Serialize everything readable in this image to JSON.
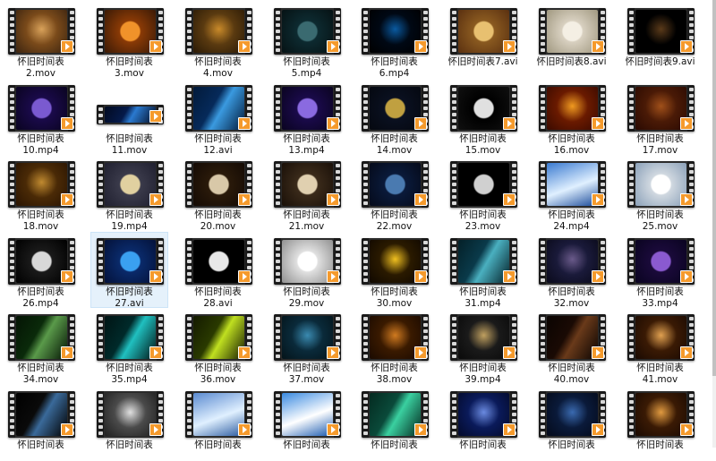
{
  "window": {
    "view": "large-icons"
  },
  "files": [
    {
      "line1": "怀旧时间表",
      "line2": "2.mov",
      "colors": [
        "#7a4a1a",
        "#d9a25a",
        "#3b2410"
      ],
      "icon": "gear-icon"
    },
    {
      "line1": "怀旧时间表",
      "line2": "3.mov",
      "colors": [
        "#8a3a06",
        "#f0922a",
        "#3a1a06"
      ],
      "icon": "clock-icon"
    },
    {
      "line1": "怀旧时间表",
      "line2": "4.mov",
      "colors": [
        "#5a3a10",
        "#c98a2a",
        "#2a1a06"
      ],
      "icon": "gear-icon"
    },
    {
      "line1": "怀旧时间表",
      "line2": "5.mp4",
      "colors": [
        "#0d2a30",
        "#3a6a70",
        "#061214"
      ],
      "icon": "clock-icon"
    },
    {
      "line1": "怀旧时间表",
      "line2": "6.mp4",
      "colors": [
        "#000814",
        "#0a5aa0",
        "#000000"
      ],
      "icon": "pendulum-icon"
    },
    {
      "line1": "怀旧时间表7.avi",
      "line2": "",
      "colors": [
        "#8a5a20",
        "#e8c070",
        "#5a3010"
      ],
      "icon": "clock-icon"
    },
    {
      "line1": "怀旧时间表8.avi",
      "line2": "",
      "colors": [
        "#d8d0c0",
        "#f4efe4",
        "#a09880"
      ],
      "icon": "clock-icon"
    },
    {
      "line1": "怀旧时间表9.avi",
      "line2": "",
      "colors": [
        "#000000",
        "#5a3a1a",
        "#000000"
      ],
      "icon": "lantern-icon"
    },
    {
      "line1": "怀旧时间表",
      "line2": "10.mp4",
      "colors": [
        "#1a0a4a",
        "#7a5ad0",
        "#0a0420"
      ],
      "icon": "clock-icon"
    },
    {
      "line1": "怀旧时间表",
      "line2": "11.mov",
      "colors": [
        "#051a4a",
        "#2a7ad0",
        "#020a20"
      ],
      "icon": "light-icon",
      "short": true
    },
    {
      "line1": "怀旧时间表",
      "line2": "12.avi",
      "colors": [
        "#062a5a",
        "#3a9ae0",
        "#021a3a"
      ],
      "icon": "light-icon"
    },
    {
      "line1": "怀旧时间表",
      "line2": "13.mp4",
      "colors": [
        "#1a0a4a",
        "#8a6ae0",
        "#0a0420"
      ],
      "icon": "clock-icon"
    },
    {
      "line1": "怀旧时间表",
      "line2": "14.mov",
      "colors": [
        "#0a1020",
        "#c0a040",
        "#050810"
      ],
      "icon": "clock-icon"
    },
    {
      "line1": "怀旧时间表",
      "line2": "15.mov",
      "colors": [
        "#000000",
        "#e0e0e0",
        "#101010"
      ],
      "icon": "clock-icon"
    },
    {
      "line1": "怀旧时间表",
      "line2": "16.mov",
      "colors": [
        "#6a1a00",
        "#f09a20",
        "#3a0a00"
      ],
      "icon": "gear-icon"
    },
    {
      "line1": "怀旧时间表",
      "line2": "17.mov",
      "colors": [
        "#4a1a06",
        "#a0501a",
        "#2a0a02"
      ],
      "icon": "gear-icon"
    },
    {
      "line1": "怀旧时间表",
      "line2": "18.mov",
      "colors": [
        "#4a2a06",
        "#c08a30",
        "#2a1402"
      ],
      "icon": "gear-icon"
    },
    {
      "line1": "怀旧时间表",
      "line2": "19.mp4",
      "colors": [
        "#3a3a4a",
        "#e0d0a0",
        "#202030"
      ],
      "icon": "clock-icon"
    },
    {
      "line1": "怀旧时间表",
      "line2": "20.mov",
      "colors": [
        "#2a1a0a",
        "#d8c8a8",
        "#140a04"
      ],
      "icon": "clock-icon"
    },
    {
      "line1": "怀旧时间表",
      "line2": "21.mov",
      "colors": [
        "#3a2a1a",
        "#e0d0b0",
        "#1a1008"
      ],
      "icon": "clock-icon"
    },
    {
      "line1": "怀旧时间表",
      "line2": "22.mov",
      "colors": [
        "#0a1a3a",
        "#4a7ab0",
        "#050a1a"
      ],
      "icon": "clock-icon"
    },
    {
      "line1": "怀旧时间表",
      "line2": "23.mov",
      "colors": [
        "#000000",
        "#d0d0d0",
        "#000000"
      ],
      "icon": "clock-icon"
    },
    {
      "line1": "怀旧时间表",
      "line2": "24.mp4",
      "colors": [
        "#3a7ad0",
        "#e0f0ff",
        "#1a4a9a"
      ],
      "icon": "sky-icon"
    },
    {
      "line1": "怀旧时间表",
      "line2": "25.mov",
      "colors": [
        "#d0d8e0",
        "#ffffff",
        "#8aa0b8"
      ],
      "icon": "clock-icon"
    },
    {
      "line1": "怀旧时间表",
      "line2": "26.mp4",
      "colors": [
        "#1a1a1a",
        "#d8d8d8",
        "#000000"
      ],
      "icon": "clock-icon"
    },
    {
      "line1": "怀旧时间表",
      "line2": "27.avi",
      "colors": [
        "#0a2a6a",
        "#3aa0f0",
        "#04123a"
      ],
      "icon": "clock-icon",
      "selected": true
    },
    {
      "line1": "怀旧时间表",
      "line2": "28.avi",
      "colors": [
        "#000000",
        "#e8e8e8",
        "#000000"
      ],
      "icon": "clock-icon"
    },
    {
      "line1": "怀旧时间表",
      "line2": "29.mov",
      "colors": [
        "#e0e0e0",
        "#ffffff",
        "#909090"
      ],
      "icon": "clock-icon"
    },
    {
      "line1": "怀旧时间表",
      "line2": "30.mov",
      "colors": [
        "#2a1a00",
        "#f0c020",
        "#100800"
      ],
      "icon": "sparkle-icon"
    },
    {
      "line1": "怀旧时间表",
      "line2": "31.mp4",
      "colors": [
        "#0a3a4a",
        "#4ab0c0",
        "#042028"
      ],
      "icon": "light-icon"
    },
    {
      "line1": "怀旧时间表",
      "line2": "32.mov",
      "colors": [
        "#1a1a3a",
        "#6a5a8a",
        "#0a0a1a"
      ],
      "icon": "city-icon"
    },
    {
      "line1": "怀旧时间表",
      "line2": "33.mp4",
      "colors": [
        "#1a0a3a",
        "#8a5ad0",
        "#0a0420"
      ],
      "icon": "clock-icon"
    },
    {
      "line1": "怀旧时间表",
      "line2": "34.mov",
      "colors": [
        "#0a2a0a",
        "#5a9a4a",
        "#041404"
      ],
      "icon": "light-icon"
    },
    {
      "line1": "怀旧时间表",
      "line2": "35.mp4",
      "colors": [
        "#002a2a",
        "#20c0c0",
        "#001414"
      ],
      "icon": "light-icon"
    },
    {
      "line1": "怀旧时间表",
      "line2": "36.mov",
      "colors": [
        "#2a3a00",
        "#c0e020",
        "#141a00"
      ],
      "icon": "light-icon"
    },
    {
      "line1": "怀旧时间表",
      "line2": "37.mov",
      "colors": [
        "#0a2a3a",
        "#3a8ab0",
        "#04141a"
      ],
      "icon": "gear-icon"
    },
    {
      "line1": "怀旧时间表",
      "line2": "38.mov",
      "colors": [
        "#3a1a00",
        "#d07a20",
        "#1a0a00"
      ],
      "icon": "city-icon"
    },
    {
      "line1": "怀旧时间表",
      "line2": "39.mp4",
      "colors": [
        "#1a1a1a",
        "#c0a060",
        "#0a0a0a"
      ],
      "icon": "coin-icon"
    },
    {
      "line1": "怀旧时间表",
      "line2": "40.mov",
      "colors": [
        "#1a0a04",
        "#6a3a1a",
        "#0a0402"
      ],
      "icon": "light-icon"
    },
    {
      "line1": "怀旧时间表",
      "line2": "41.mov",
      "colors": [
        "#3a1a04",
        "#e0a050",
        "#1a0a02"
      ],
      "icon": "city-icon"
    },
    {
      "line1": "怀旧时间表",
      "line2": "",
      "colors": [
        "#0a0a0a",
        "#3a6a9a",
        "#000000"
      ],
      "icon": "light-icon"
    },
    {
      "line1": "怀旧时间表",
      "line2": "",
      "colors": [
        "#4a4a4a",
        "#e0e0e0",
        "#202020"
      ],
      "icon": "text-icon"
    },
    {
      "line1": "怀旧时间表",
      "line2": "",
      "colors": [
        "#5a8ad0",
        "#e0f0ff",
        "#2a5aa0"
      ],
      "icon": "sky-icon"
    },
    {
      "line1": "怀旧时间表",
      "line2": "",
      "colors": [
        "#3a8ae0",
        "#ffffff",
        "#1a5ab0"
      ],
      "icon": "sky-icon"
    },
    {
      "line1": "怀旧时间表",
      "line2": "",
      "colors": [
        "#0a4a3a",
        "#3ad0a0",
        "#042a20"
      ],
      "icon": "light-icon"
    },
    {
      "line1": "怀旧时间表",
      "line2": "",
      "colors": [
        "#0a1a5a",
        "#6a8ae0",
        "#040a2a"
      ],
      "icon": "sparkle-icon"
    },
    {
      "line1": "怀旧时间表",
      "line2": "",
      "colors": [
        "#0a1a3a",
        "#3a6ab0",
        "#040a1a"
      ],
      "icon": "city-icon"
    },
    {
      "line1": "怀旧时间表",
      "line2": "",
      "colors": [
        "#3a1a04",
        "#e09a40",
        "#1a0a02"
      ],
      "icon": "sparkle-icon"
    }
  ]
}
